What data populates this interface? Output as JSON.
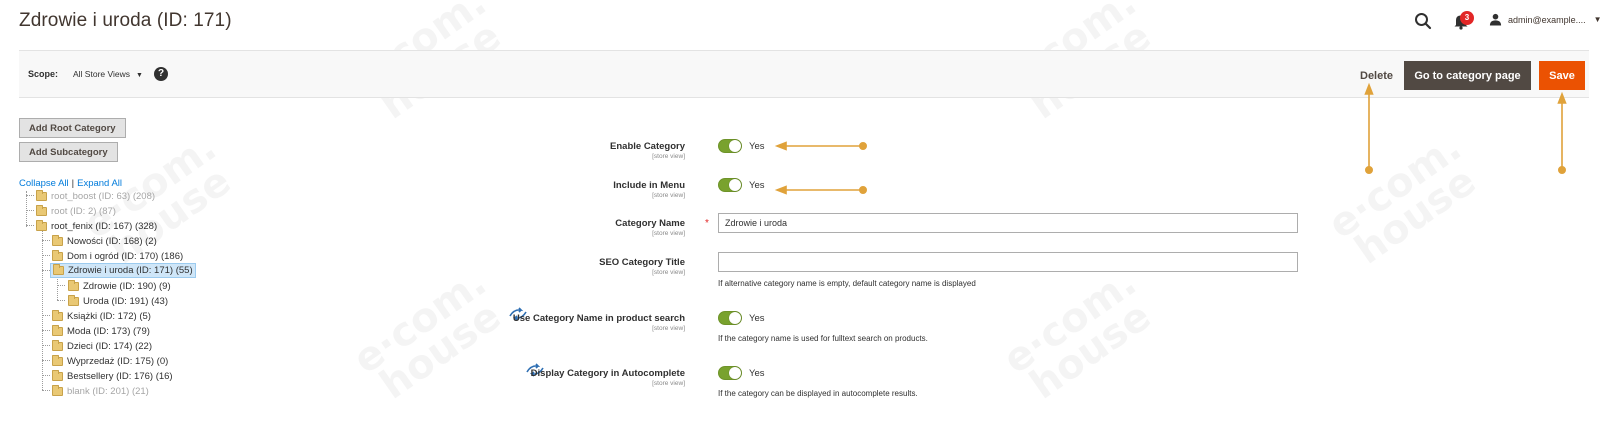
{
  "header": {
    "title": "Zdrowie i uroda (ID: 171)",
    "notifications_count": "3",
    "user": "admin@example...."
  },
  "scope_bar": {
    "scope_label": "Scope:",
    "scope_value": "All Store Views",
    "help": "?",
    "delete_label": "Delete",
    "goto_label": "Go to category page",
    "save_label": "Save"
  },
  "tree_panel": {
    "add_root_label": "Add Root Category",
    "add_sub_label": "Add Subcategory",
    "collapse_all": "Collapse All",
    "separator": "|",
    "expand_all": "Expand All",
    "items": [
      {
        "label": "root_boost (ID: 63) (208)",
        "muted": true
      },
      {
        "label": "root (ID: 2) (87)",
        "muted": true
      },
      {
        "label": "root_fenix (ID: 167) (328)",
        "muted": false
      },
      {
        "label": "Nowości (ID: 168) (2)",
        "muted": false
      },
      {
        "label": "Dom i ogród (ID: 170) (186)",
        "muted": false
      },
      {
        "label": "Zdrowie i uroda (ID: 171) (55)",
        "muted": false,
        "selected": true
      },
      {
        "label": "Zdrowie (ID: 190) (9)",
        "muted": false
      },
      {
        "label": "Uroda (ID: 191) (43)",
        "muted": false
      },
      {
        "label": "Książki (ID: 172) (5)",
        "muted": false
      },
      {
        "label": "Moda (ID: 173) (79)",
        "muted": false
      },
      {
        "label": "Dzieci (ID: 174) (22)",
        "muted": false
      },
      {
        "label": "Wyprzedaż (ID: 175) (0)",
        "muted": false
      },
      {
        "label": "Bestsellery (ID: 176) (16)",
        "muted": false
      },
      {
        "label": "blank (ID: 201) (21)",
        "muted": true
      }
    ]
  },
  "form": {
    "enable_category": {
      "label": "Enable Category",
      "scope": "[store view]",
      "value": "Yes"
    },
    "include_in_menu": {
      "label": "Include in Menu",
      "scope": "[store view]",
      "value": "Yes"
    },
    "category_name": {
      "label": "Category Name",
      "scope": "[store view]",
      "value": "Zdrowie i uroda",
      "required": "*"
    },
    "seo_title": {
      "label": "SEO Category Title",
      "scope": "[store view]",
      "value": "",
      "note": "If alternative category name is empty, default category name is displayed"
    },
    "use_in_search": {
      "label": "Use Category Name in product search",
      "scope": "[store view]",
      "value": "Yes",
      "note": "If the category name is used for fulltext search on products."
    },
    "autocomplete": {
      "label": "Display Category in Autocomplete",
      "scope": "[store view]",
      "value": "Yes",
      "note": "If the category can be displayed in autocomplete results."
    }
  },
  "colors": {
    "save": "#eb5202",
    "goto": "#514943",
    "toggle_on": "#79a22e",
    "annotation": "#e0a23a",
    "link": "#007bdb"
  },
  "icons": [
    "search-icon",
    "bell-icon",
    "user-icon",
    "help-icon",
    "folder-icon",
    "extension-icon"
  ]
}
